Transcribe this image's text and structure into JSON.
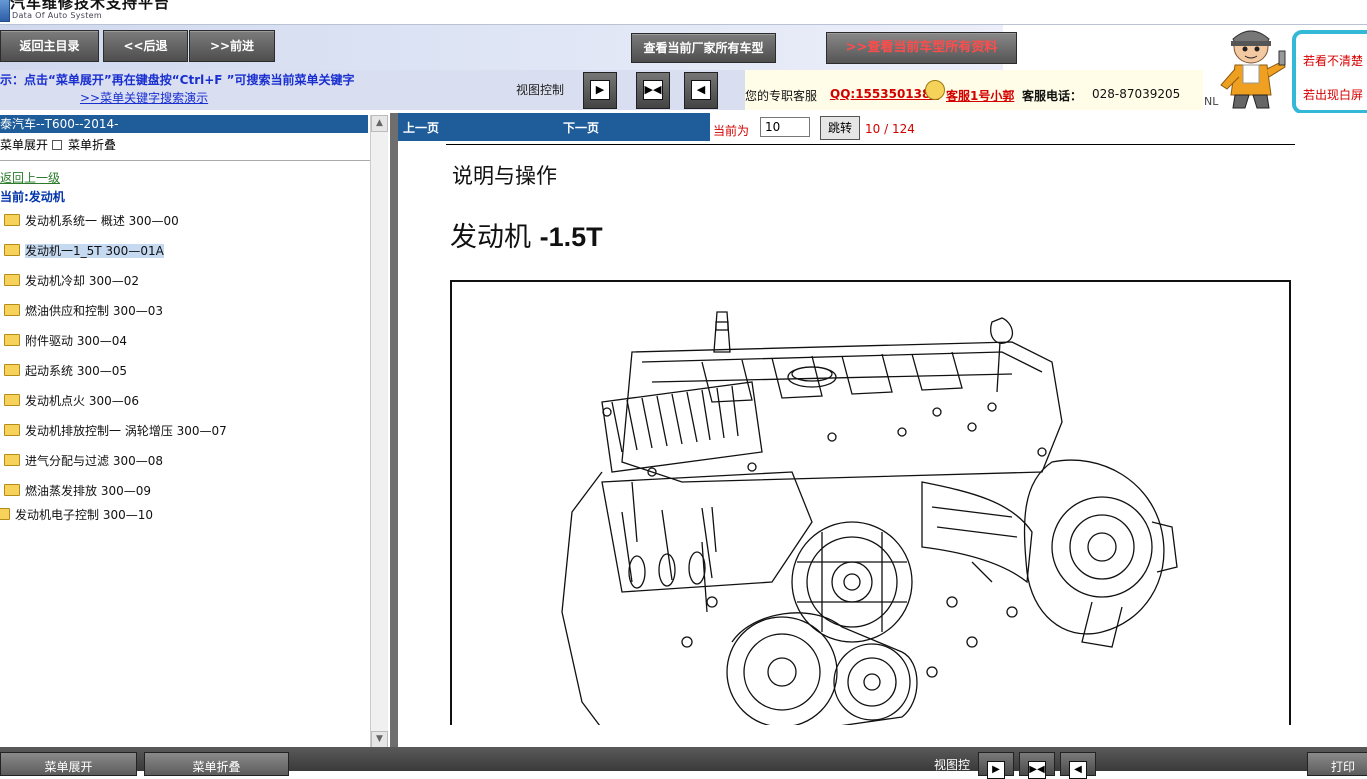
{
  "app": {
    "title": "汽车维修技术支持平台",
    "subtitle": "Data Of Auto System"
  },
  "nav": {
    "home": "返回主目录",
    "back": "<<后退",
    "forward": ">>前进",
    "all_manufacturer_models": "查看当前厂家所有车型",
    "all_model_data": ">>查看当前车型所有资料"
  },
  "hint": {
    "text": "示：点击“菜单展开”再在键盘按“Ctrl+F ”可搜索当前菜单关键字",
    "link": ">>菜单关键字搜索演示"
  },
  "view_control": {
    "label": "视图控制",
    "buttons": [
      "right-pane",
      "split",
      "left-pane"
    ]
  },
  "service": {
    "label": "您的专职客服",
    "qq": "QQ:1553501388",
    "name": "客服1号小郭",
    "phone_label": "客服电话：",
    "phone": "028-87039205",
    "nl": "NL"
  },
  "help": {
    "line1": "若看不清楚",
    "line2": "若出现白屏"
  },
  "tree": {
    "header": "泰汽车--T600--2014-",
    "expand": "菜单展开",
    "collapse": "菜单折叠",
    "up": "返回上一级",
    "current": "当前:发动机",
    "items": [
      {
        "label": "发动机系统一 概述  300—00"
      },
      {
        "label": "发动机一1_5T 300—01A"
      },
      {
        "label": "发动机冷却  300—02"
      },
      {
        "label": "燃油供应和控制  300—03"
      },
      {
        "label": "附件驱动  300—04"
      },
      {
        "label": "起动系统  300—05"
      },
      {
        "label": "发动机点火  300—06"
      },
      {
        "label": "发动机排放控制一 涡轮增压  300—07"
      },
      {
        "label": "进气分配与过滤  300—08"
      },
      {
        "label": "燃油蒸发排放  300—09"
      },
      {
        "label": "发动机电子控制  300—10"
      }
    ]
  },
  "toolbar": {
    "prev": "上一页",
    "next": "下一页",
    "current_label": "当前为",
    "page_value": "10",
    "jump": "跳转",
    "count": "10 / 124"
  },
  "doc": {
    "section": "说明与操作",
    "title_prefix": "发动机 ",
    "title_bold": "-1.5T"
  },
  "bottom": {
    "expand": "菜单展开",
    "collapse": "菜单折叠",
    "view_label": "视图控",
    "print": "打印"
  },
  "colors": {
    "tree_header": "#1e5c9a",
    "link_red": "#d30000",
    "hint_blue": "#1a2fd0",
    "help_border": "#34b8d8"
  }
}
